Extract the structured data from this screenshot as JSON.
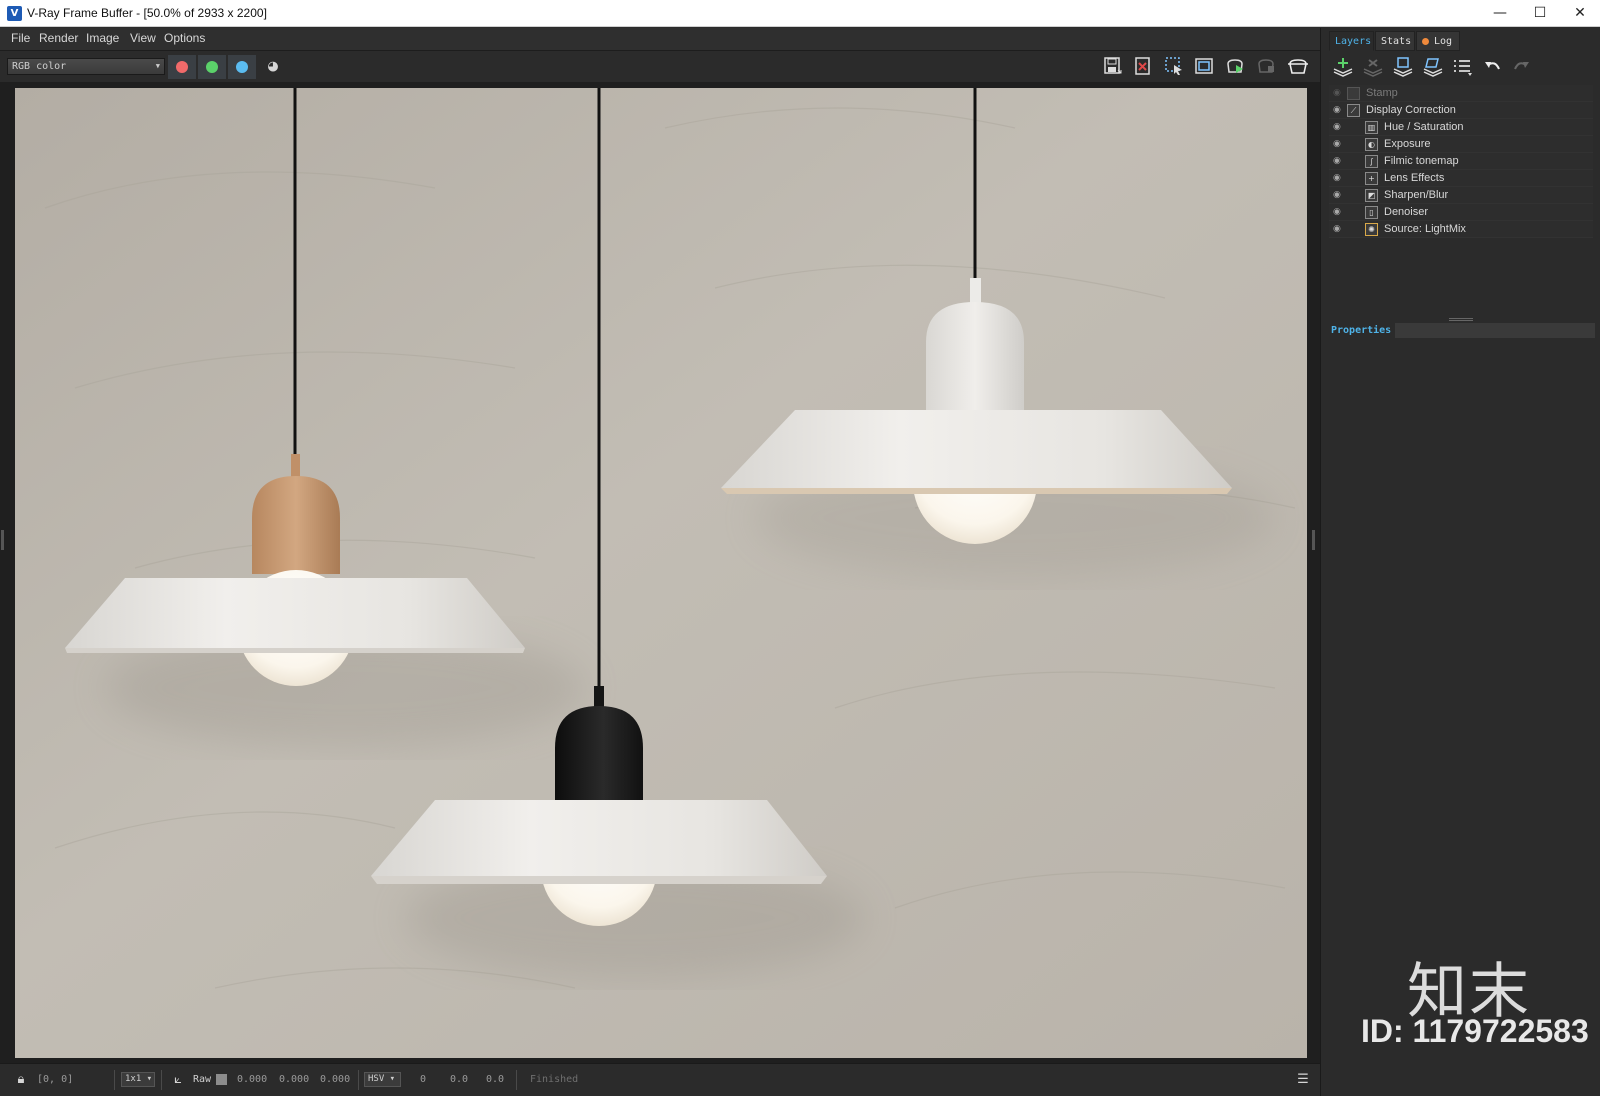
{
  "window": {
    "title": "V-Ray Frame Buffer - [50.0% of 2933 x 2200]",
    "app_icon": "vray-icon",
    "controls": [
      "minimize-icon",
      "maximize-icon",
      "close-icon"
    ],
    "minimize_glyph": "—",
    "maximize_glyph": "☐",
    "close_glyph": "✕"
  },
  "menu": {
    "items": [
      "File",
      "Render",
      "Image",
      "View",
      "Options"
    ]
  },
  "toolbar": {
    "channel": "RGB color",
    "channel_buttons": [
      {
        "name": "red-channel-button",
        "color": "#f06a6a"
      },
      {
        "name": "green-channel-button",
        "color": "#5bd16a"
      },
      {
        "name": "blue-channel-button",
        "color": "#5bbcf0"
      }
    ],
    "right_icons": [
      "save-image-icon",
      "clear-image-icon",
      "region-render-icon",
      "track-mouse-icon",
      "render-interactive-icon",
      "render-disabled-icon",
      "render-icon"
    ]
  },
  "panel": {
    "tabs": [
      "Layers",
      "Stats",
      "Log"
    ],
    "active_tab": "Layers",
    "log_has_warning": true,
    "layer_tools": [
      "add-layer-icon",
      "delete-layer-icon",
      "save-layers-icon",
      "load-layers-icon",
      "layer-list-icon",
      "undo-icon",
      "redo-icon"
    ],
    "layers": [
      {
        "label": "Stamp",
        "icon": "stamp-icon",
        "enabled": false,
        "indent": 0
      },
      {
        "label": "Display Correction",
        "icon": "curve-icon",
        "enabled": true,
        "indent": 0
      },
      {
        "label": "Hue / Saturation",
        "icon": "bars-icon",
        "enabled": true,
        "indent": 1
      },
      {
        "label": "Exposure",
        "icon": "exposure-icon",
        "enabled": true,
        "indent": 1
      },
      {
        "label": "Filmic tonemap",
        "icon": "tonemap-icon",
        "enabled": true,
        "indent": 1
      },
      {
        "label": "Lens Effects",
        "icon": "lens-icon",
        "enabled": true,
        "indent": 1
      },
      {
        "label": "Sharpen/Blur",
        "icon": "sharpen-icon",
        "enabled": true,
        "indent": 1
      },
      {
        "label": "Denoiser",
        "icon": "denoiser-icon",
        "enabled": true,
        "indent": 1
      },
      {
        "label": "Source: LightMix",
        "icon": "lightmix-icon",
        "enabled": true,
        "indent": 1
      }
    ],
    "properties_label": "Properties",
    "watermark_logo": "知末",
    "watermark_id": "ID: 1179722583"
  },
  "status": {
    "coords": "[0, 0]",
    "zoom": "1x1",
    "mode": "Raw",
    "r": "0.000",
    "g": "0.000",
    "b": "0.000",
    "color_space": "HSV",
    "h": "0",
    "s": "0.0",
    "v": "0.0",
    "state": "Finished"
  },
  "colors": {
    "accent": "#4fb3e8",
    "wall": "#bdb7ae",
    "lamp_left_cap": "#c99a72",
    "lamp_middle_cap": "#1b1b1b",
    "lamp_right_cap": "#e8e6e2",
    "shade": "#ebe9e5"
  }
}
